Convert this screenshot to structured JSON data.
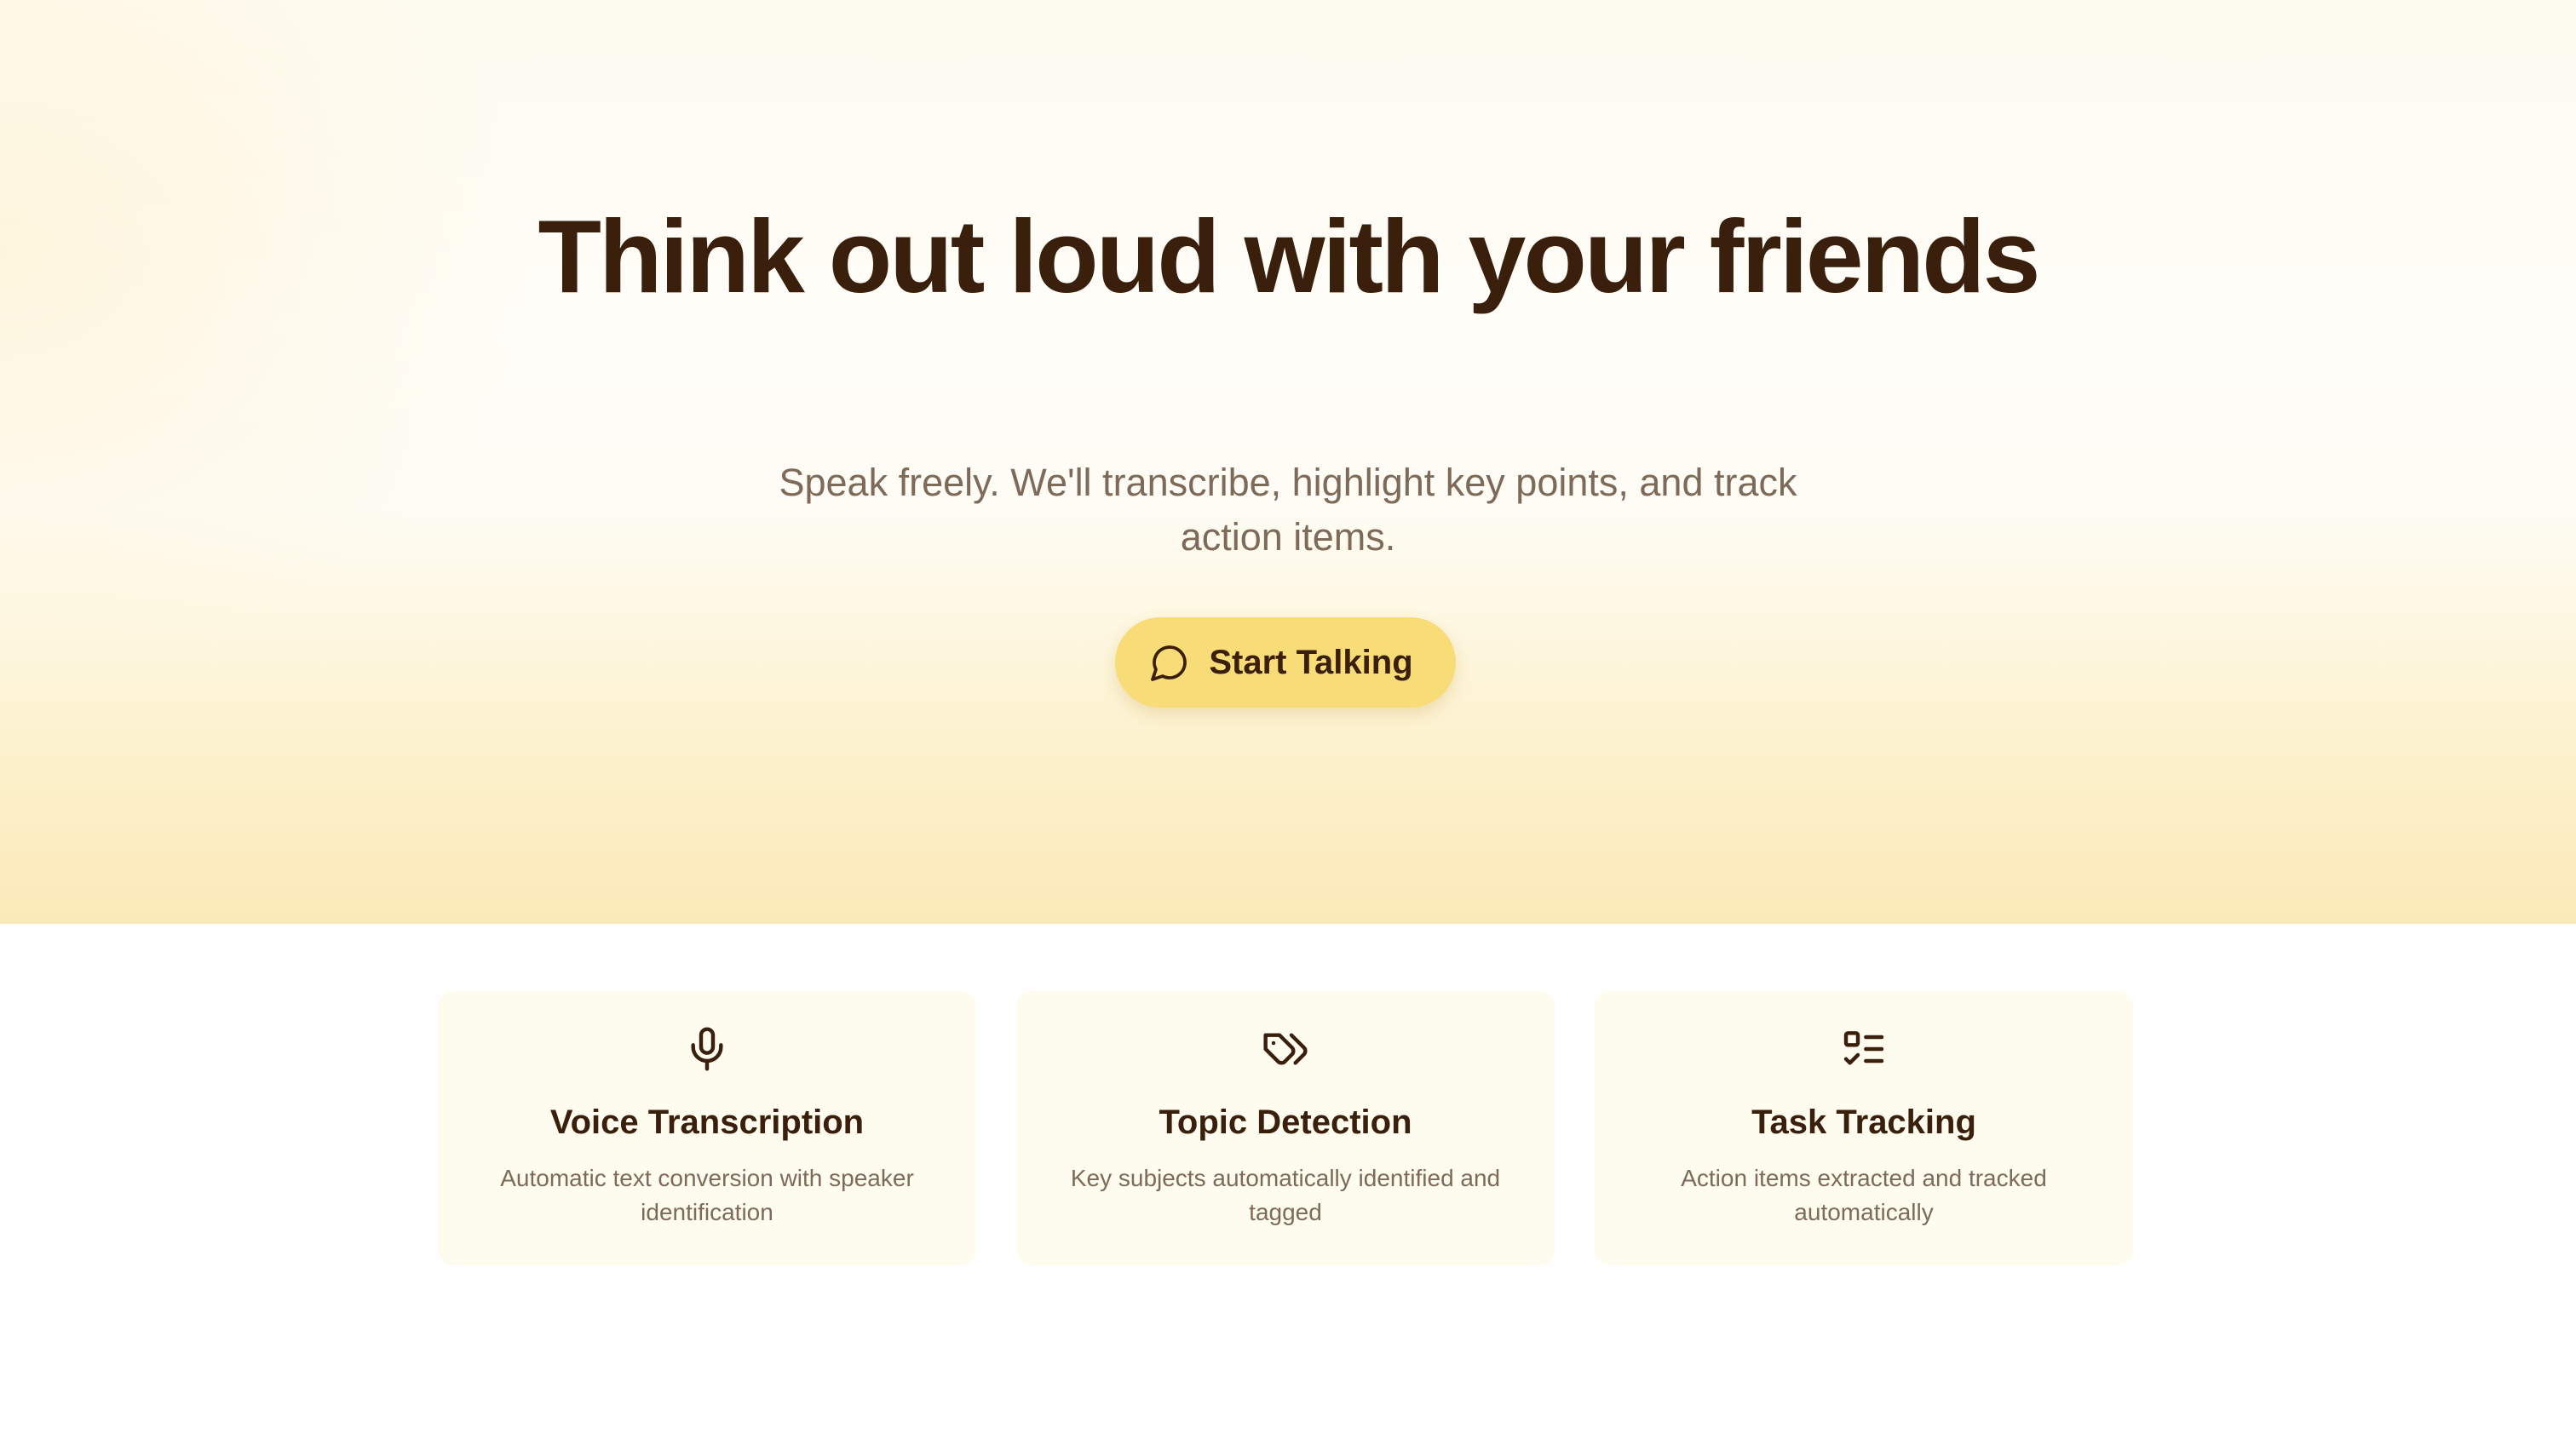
{
  "hero": {
    "headline": "Think out loud with your friends",
    "subtitle": "Speak freely. We'll transcribe, highlight key points, and track action items.",
    "cta": {
      "label": "Start Talking",
      "icon": "chat-bubble-icon"
    }
  },
  "features": [
    {
      "icon": "microphone-icon",
      "title": "Voice Transcription",
      "description": "Automatic text conversion with speaker identification"
    },
    {
      "icon": "tags-icon",
      "title": "Topic Detection",
      "description": "Key subjects automatically identified and tagged"
    },
    {
      "icon": "checklist-icon",
      "title": "Task Tracking",
      "description": "Action items extracted and tracked automatically"
    }
  ],
  "colors": {
    "text_dark": "#3a200c",
    "text_muted": "#7d6a58",
    "button": "#f8dc78",
    "card_bg": "#fefbef",
    "hero_bottom": "#fbe9b8"
  }
}
